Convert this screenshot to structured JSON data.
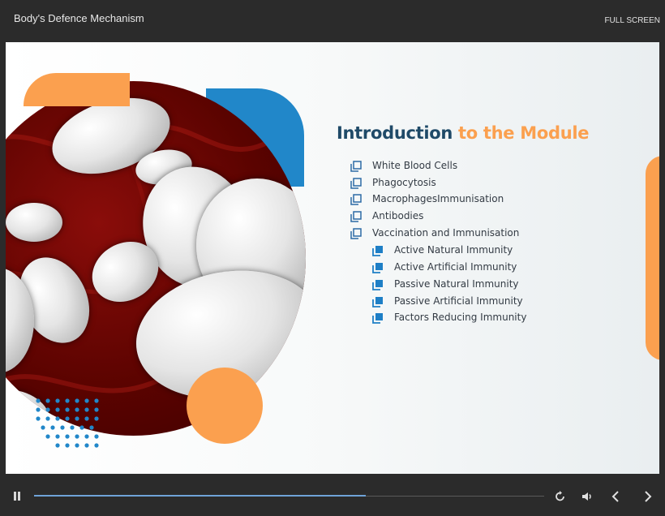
{
  "app": {
    "title": "Body's Defence Mechanism",
    "fullscreen_label": "FULL SCREEN"
  },
  "slide": {
    "heading_part1": "Introduction",
    "heading_part2": " to the Module",
    "topics": [
      {
        "label": "White Blood Cells",
        "level": 1,
        "icon": "copy-outline-icon"
      },
      {
        "label": "Phagocytosis",
        "level": 1,
        "icon": "copy-outline-icon"
      },
      {
        "label": "MacrophagesImmunisation",
        "level": 1,
        "icon": "copy-outline-icon"
      },
      {
        "label": "Antibodies",
        "level": 1,
        "icon": "copy-outline-icon"
      },
      {
        "label": "Vaccination and Immunisation",
        "level": 1,
        "icon": "copy-outline-icon"
      },
      {
        "label": "Active Natural Immunity",
        "level": 2,
        "icon": "copy-filled-icon"
      },
      {
        "label": "Active Artificial Immunity",
        "level": 2,
        "icon": "copy-filled-icon"
      },
      {
        "label": "Passive Natural Immunity",
        "level": 2,
        "icon": "copy-filled-icon"
      },
      {
        "label": "Passive Artificial Immunity",
        "level": 2,
        "icon": "copy-filled-icon"
      },
      {
        "label": "Factors Reducing Immunity",
        "level": 2,
        "icon": "copy-filled-icon"
      }
    ],
    "image": "red-and-white-blood-cells"
  },
  "player": {
    "progress": 0.65,
    "controls": [
      "pause-icon",
      "replay-icon",
      "volume-icon",
      "previous-icon",
      "next-icon"
    ]
  },
  "colors": {
    "heading_dark": "#1f4a68",
    "accent_orange": "#fba04f",
    "accent_blue": "#2187c9",
    "bar_bg": "#2b2b2b",
    "progress": "#6fa3d8"
  }
}
